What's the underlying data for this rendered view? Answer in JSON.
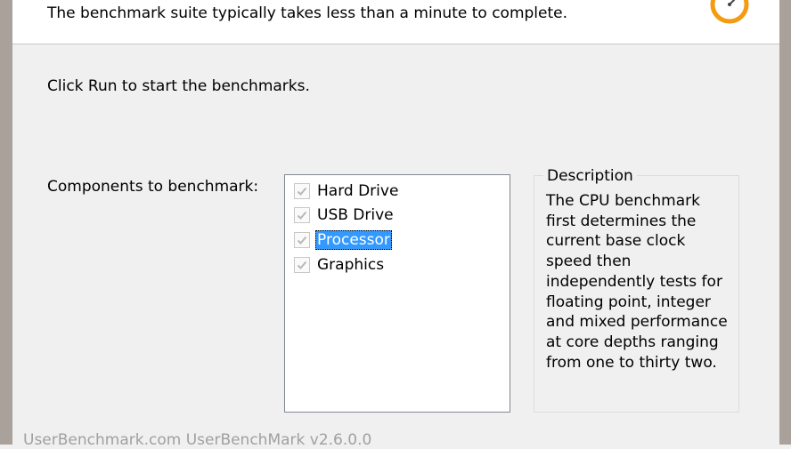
{
  "header": {
    "text": "The benchmark suite typically takes less than a minute to complete.",
    "icon": "stopwatch-icon",
    "accent_color": "#f39c12"
  },
  "instruction": "Click Run to start the benchmarks.",
  "components_label": "Components to benchmark:",
  "components": [
    {
      "label": "Hard Drive",
      "checked": true,
      "selected": false
    },
    {
      "label": "USB Drive",
      "checked": true,
      "selected": false
    },
    {
      "label": "Processor",
      "checked": true,
      "selected": true
    },
    {
      "label": "Graphics",
      "checked": true,
      "selected": false
    }
  ],
  "description": {
    "title": "Description",
    "text": "The CPU benchmark first determines the current base clock speed then independently tests for floating point, integer and mixed performance at core depths ranging from one to thirty two."
  },
  "footer": "UserBenchmark.com UserBenchMark v2.6.0.0"
}
